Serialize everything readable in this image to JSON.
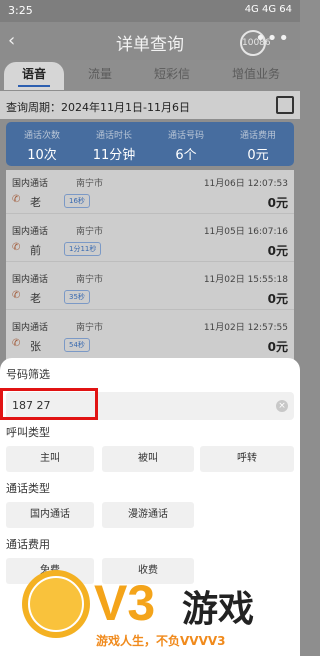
{
  "status_bar": {
    "time": "3:25",
    "signal_text": "4G 4G 64"
  },
  "header": {
    "back_icon": "chevron-left-icon",
    "title": "详单查询",
    "svc_label": "10086",
    "more_icon": "more-icon"
  },
  "tabs": [
    {
      "label": "语音"
    },
    {
      "label": "流量"
    },
    {
      "label": "短彩信"
    },
    {
      "label": "增值业务"
    }
  ],
  "period": {
    "label": "查询周期：2024年11月1日-11月6日"
  },
  "summary": [
    {
      "k": "通话次数",
      "v": "10次"
    },
    {
      "k": "通话时长",
      "v": "11分钟"
    },
    {
      "k": "通话号码",
      "v": "6个"
    },
    {
      "k": "通话费用",
      "v": "0元"
    }
  ],
  "list": [
    {
      "type": "国内通话",
      "city": "南宁市",
      "date": "11月06日 12:07:53",
      "name": "老",
      "dur": "16秒",
      "fee": "0元"
    },
    {
      "type": "国内通话",
      "city": "南宁市",
      "date": "11月05日 16:07:16",
      "name": "前",
      "dur": "1分11秒",
      "fee": "0元"
    },
    {
      "type": "国内通话",
      "city": "南宁市",
      "date": "11月02日 15:55:18",
      "name": "老",
      "dur": "35秒",
      "fee": "0元"
    },
    {
      "type": "国内通话",
      "city": "南宁市",
      "date": "11月02日 12:57:55",
      "name": "张",
      "dur": "54秒",
      "fee": "0元"
    }
  ],
  "sheet": {
    "number_filter_title": "号码筛选",
    "number_value": "187  27",
    "call_type_title": "呼叫类型",
    "call_type_options": [
      "主叫",
      "被叫",
      "呼转"
    ],
    "comm_type_title": "通话类型",
    "comm_type_options": [
      "国内通话",
      "漫游通话"
    ],
    "fee_title": "通话费用",
    "fee_options": [
      "免费",
      "收费"
    ]
  },
  "watermark": {
    "brand": "V3",
    "brand_cn": "游戏",
    "slogan": "游戏人生，不负VVVV3"
  }
}
